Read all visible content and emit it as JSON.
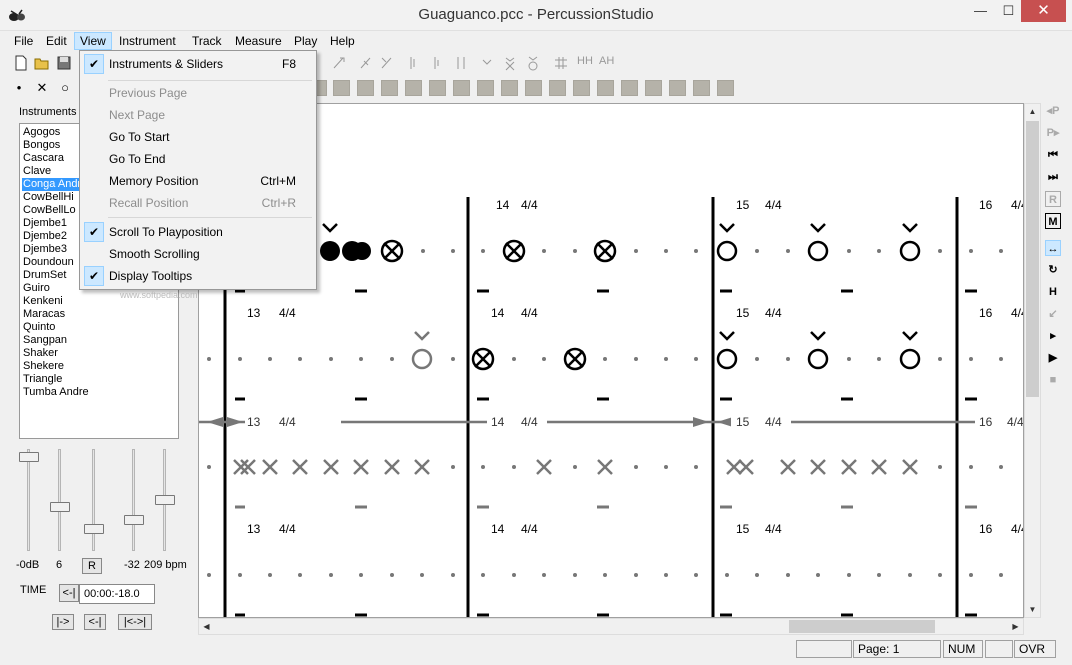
{
  "window": {
    "title": "Guaguanco.pcc - PercussionStudio",
    "minimize": "—",
    "maximize": "☐",
    "close": "✕"
  },
  "menubar": {
    "items": [
      "File",
      "Edit",
      "View",
      "Instrument",
      "Track",
      "Measure",
      "Play",
      "Help"
    ]
  },
  "view_menu": {
    "items": [
      {
        "label": "Instruments & Sliders",
        "shortcut": "F8",
        "checked": true,
        "enabled": true
      },
      {
        "label": "Previous Page",
        "shortcut": "",
        "checked": false,
        "enabled": false
      },
      {
        "label": "Next Page",
        "shortcut": "",
        "checked": false,
        "enabled": false
      },
      {
        "label": "Go To Start",
        "shortcut": "",
        "checked": false,
        "enabled": true
      },
      {
        "label": "Go To End",
        "shortcut": "",
        "checked": false,
        "enabled": true
      },
      {
        "label": "Memory Position",
        "shortcut": "Ctrl+M",
        "checked": false,
        "enabled": true
      },
      {
        "label": "Recall Position",
        "shortcut": "Ctrl+R",
        "checked": false,
        "enabled": false
      },
      {
        "label": "Scroll To Playposition",
        "shortcut": "",
        "checked": true,
        "enabled": true
      },
      {
        "label": "Smooth Scrolling",
        "shortcut": "",
        "checked": false,
        "enabled": true
      },
      {
        "label": "Display Tooltips",
        "shortcut": "",
        "checked": true,
        "enabled": true
      }
    ]
  },
  "toolbar": {
    "chord_labels": [
      "HH",
      "AH"
    ]
  },
  "rest_toolbar": {
    "symbols": [
      "•",
      "✕",
      "○"
    ]
  },
  "instruments": {
    "label": "Instruments",
    "items": [
      "Agogos",
      "Bongos",
      "Cascara",
      "Clave",
      "Conga Andre",
      "CowBellHi",
      "CowBellLo",
      "Djembe1",
      "Djembe2",
      "Djembe3",
      "Doundoun",
      "DrumSet",
      "Guiro",
      "Kenkeni",
      "Maracas",
      "Quinto",
      "Sangpan",
      "Shaker",
      "Shekere",
      "Triangle",
      "Tumba Andre"
    ],
    "selected_index": 4
  },
  "sliders": {
    "values": [
      "-0dB",
      "6",
      "-32",
      "209 bpm"
    ],
    "positions": [
      0.03,
      0.58,
      0.82,
      0.72,
      0.5
    ],
    "reset_label": "R"
  },
  "time": {
    "label": "TIME",
    "reset_label": "<-|",
    "value": "00:00:-18.0",
    "buttons": [
      "|->",
      "<-|",
      "|<->|"
    ]
  },
  "score": {
    "measure_numbers": [
      "13",
      "14",
      "15",
      "16"
    ],
    "time_signature": "4/4"
  },
  "status": {
    "page": "Page: 1",
    "num": "NUM",
    "ovr": "OVR"
  },
  "right_toolbar": {
    "labels": [
      "◂P",
      "P▸",
      "⏮",
      "⏭",
      "R",
      "M",
      "↔",
      "↻",
      "H",
      "↙",
      "▸",
      "▶",
      "■"
    ]
  },
  "watermark": "www.softpedia.com"
}
